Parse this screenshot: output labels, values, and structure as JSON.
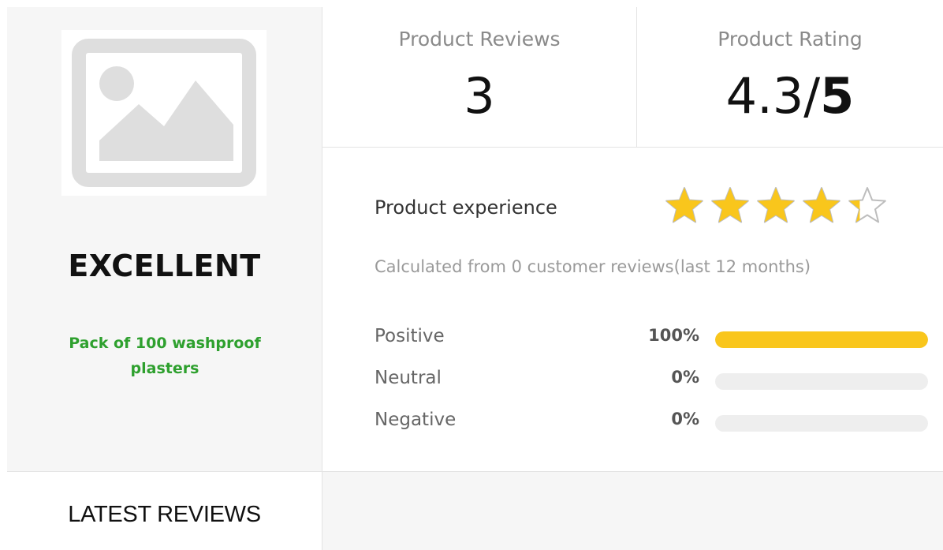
{
  "left": {
    "grade": "EXCELLENT",
    "product_name": "Pack of 100 washproof plasters",
    "latest_reviews": "LATEST REVIEWS"
  },
  "stats": {
    "reviews_label": "Product Reviews",
    "reviews_value": "3",
    "rating_label": "Product Rating",
    "rating_value": "4.3",
    "rating_slash": "/",
    "rating_max": "5"
  },
  "experience": {
    "label": "Product experience",
    "star_rating": 4.3,
    "star_max": 5,
    "note": "Calculated from 0 customer reviews(last 12 months)"
  },
  "sentiment": [
    {
      "label": "Positive",
      "percent_text": "100%",
      "fraction": 1.0
    },
    {
      "label": "Neutral",
      "percent_text": "0%",
      "fraction": 0.0
    },
    {
      "label": "Negative",
      "percent_text": "0%",
      "fraction": 0.0
    }
  ],
  "colors": {
    "accent_yellow": "#f9c61c",
    "product_name_green": "#2ea02e",
    "panel_gray": "#f6f6f6"
  }
}
